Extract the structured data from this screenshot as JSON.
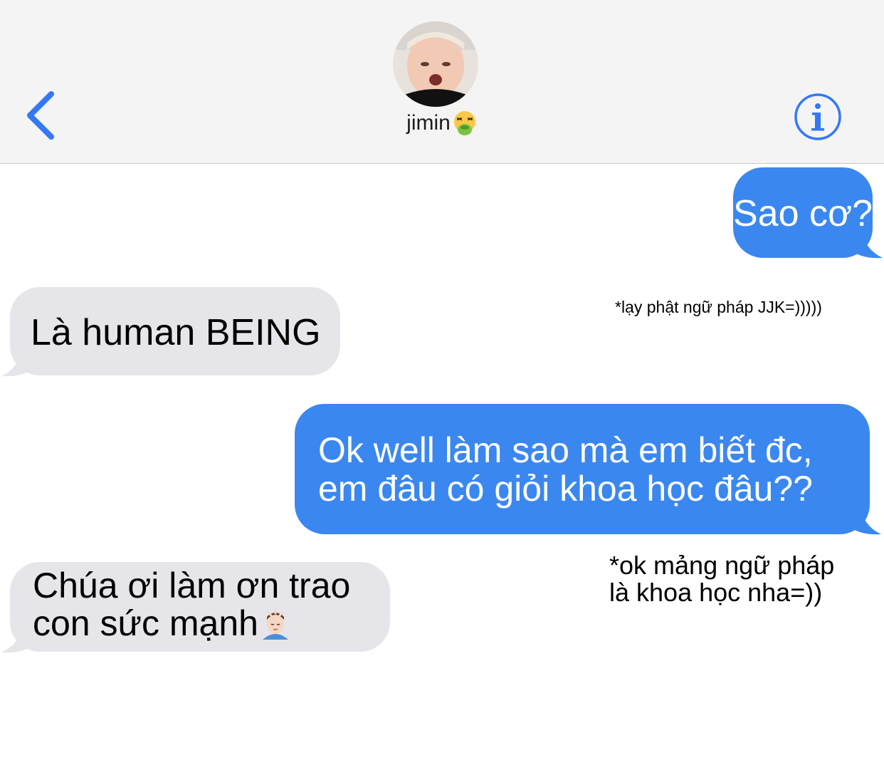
{
  "header": {
    "contact_name": "jimin",
    "contact_emoji": "nauseated-face-icon",
    "accent_color": "#3478f6",
    "back_icon": "chevron-left-icon",
    "info_icon": "info-icon"
  },
  "messages": [
    {
      "side": "sent",
      "text": "Sao cơ?"
    },
    {
      "side": "received",
      "text": "Là human BEING"
    },
    {
      "side": "sent",
      "lines": [
        "Ok well làm sao mà em biết đc,",
        "em đâu có giỏi khoa học đâu??"
      ]
    },
    {
      "side": "received",
      "lines": [
        "Chúa ơi làm ơn trao",
        "con sức mạnh"
      ],
      "emoji": "person-getting-massage-icon"
    }
  ],
  "notes": {
    "note1": "*lạy phật ngữ pháp JJK=)))))",
    "note2_lines": [
      "*ok mảng ngữ pháp",
      "là khoa học nha=))"
    ]
  },
  "colors": {
    "sent_bubble": "#3b87f0",
    "received_bubble": "#e5e5ea",
    "header_bg": "#f4f4f4"
  }
}
